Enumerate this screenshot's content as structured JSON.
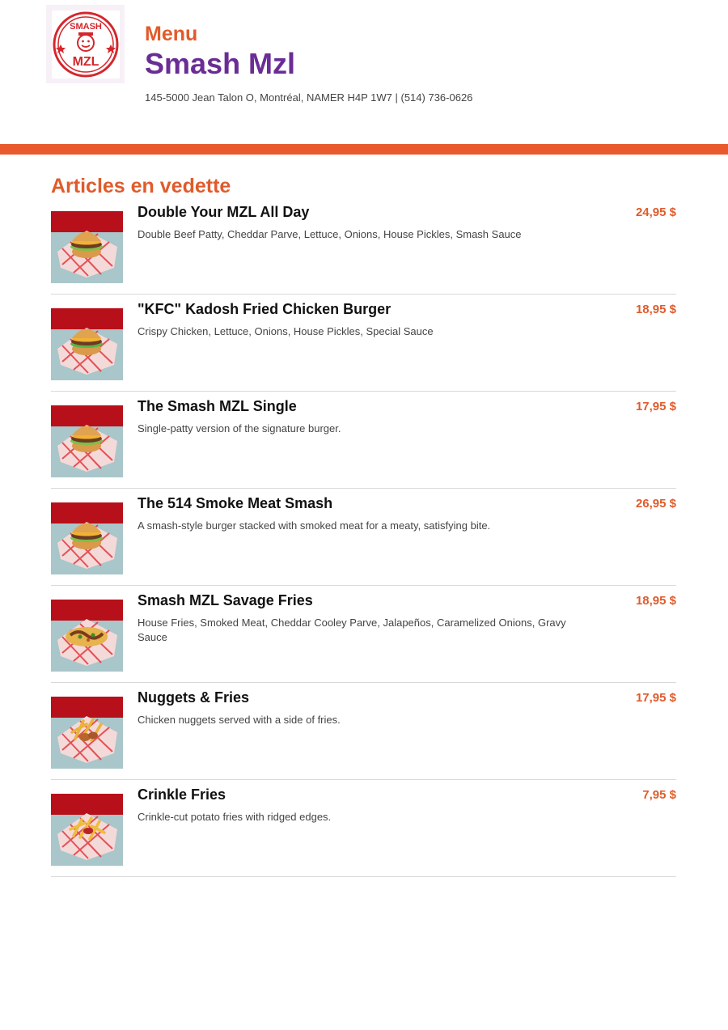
{
  "header": {
    "kicker": "Menu",
    "restaurant_name": "Smash Mzl",
    "address_line": "145-5000 Jean Talon O, Montréal, NAMER H4P 1W7 | (514) 736-0626",
    "logo": {
      "top_text": "SMASH",
      "bottom_text": "MZL",
      "icon": "mascot-logo-icon"
    }
  },
  "colors": {
    "accent_orange": "#e05b2b",
    "title_purple": "#6a2d96",
    "bar_orange": "#e85a2d",
    "logo_red": "#d4262c"
  },
  "section": {
    "title": "Articles en vedette",
    "items": [
      {
        "name": "Double Your MZL All Day",
        "description": "Double Beef Patty, Cheddar Parve, Lettuce, Onions, House Pickles, Smash Sauce",
        "price": "24,95 $",
        "image": "burger"
      },
      {
        "name": "\"KFC\" Kadosh Fried Chicken Burger",
        "description": "Crispy Chicken, Lettuce, Onions, House Pickles, Special Sauce",
        "price": "18,95 $",
        "image": "chicken-burger"
      },
      {
        "name": "The Smash MZL Single",
        "description": "Single-patty version of the signature burger.",
        "price": "17,95 $",
        "image": "burger"
      },
      {
        "name": "The 514 Smoke Meat Smash",
        "description": "A smash-style burger stacked with smoked meat for a meaty, satisfying bite.",
        "price": "26,95 $",
        "image": "burger"
      },
      {
        "name": "Smash MZL Savage Fries",
        "description": "House Fries, Smoked Meat, Cheddar Cooley Parve, Jalapeños, Caramelized Onions, Gravy Sauce",
        "price": "18,95 $",
        "image": "loaded-fries"
      },
      {
        "name": "Nuggets & Fries",
        "description": "Chicken nuggets served with a side of fries.",
        "price": "17,95 $",
        "image": "nuggets-fries"
      },
      {
        "name": "Crinkle Fries",
        "description": "Crinkle-cut potato fries with ridged edges.",
        "price": "7,95 $",
        "image": "fries"
      }
    ]
  }
}
